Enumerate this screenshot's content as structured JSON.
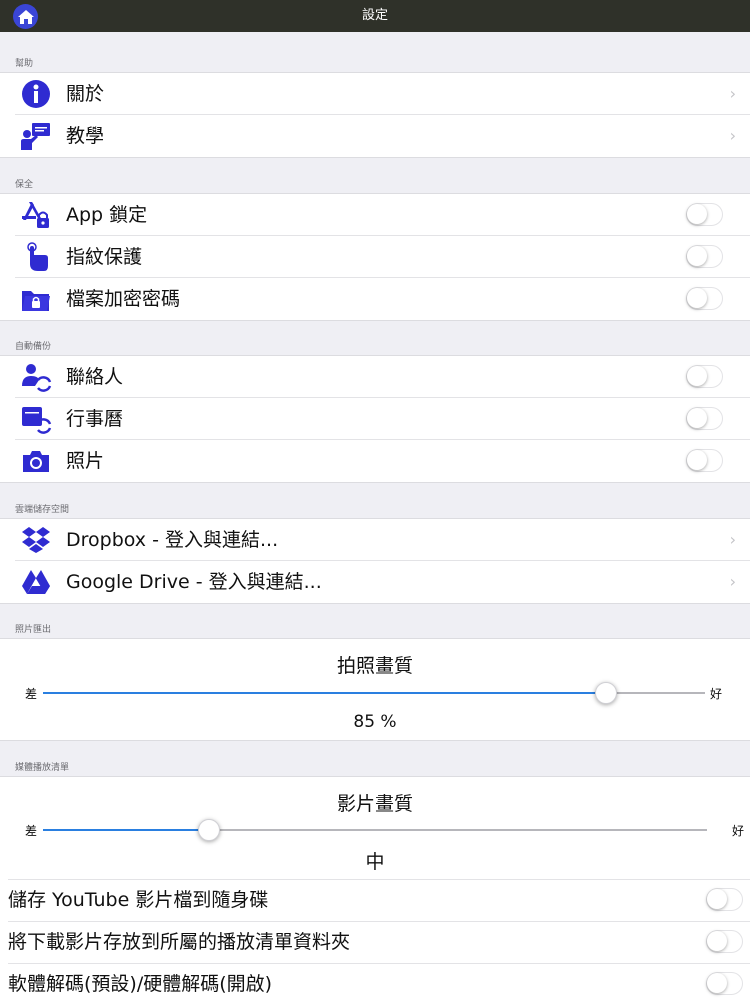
{
  "topbar": {
    "title": "設定"
  },
  "sections": {
    "help": {
      "header": "幫助",
      "items": [
        {
          "label": "關於",
          "icon": "info-icon"
        },
        {
          "label": "教學",
          "icon": "tutorial-icon"
        }
      ]
    },
    "security": {
      "header": "保全",
      "items": [
        {
          "label": "App 鎖定",
          "icon": "app-lock-icon"
        },
        {
          "label": "指紋保護",
          "icon": "fingerprint-touch-icon"
        },
        {
          "label": "檔案加密密碼",
          "icon": "folder-lock-icon"
        }
      ]
    },
    "auto_backup": {
      "header": "自動備份",
      "items": [
        {
          "label": "聯絡人",
          "icon": "contacts-sync-icon"
        },
        {
          "label": "行事曆",
          "icon": "calendar-sync-icon"
        },
        {
          "label": "照片",
          "icon": "camera-icon"
        }
      ]
    },
    "cloud": {
      "header": "雲端儲存空間",
      "items": [
        {
          "label": "Dropbox - 登入與連結...",
          "icon": "dropbox-icon"
        },
        {
          "label": "Google Drive - 登入與連結...",
          "icon": "google-drive-icon"
        }
      ]
    },
    "photo_export": {
      "header": "照片匯出",
      "slider": {
        "title": "拍照畫質",
        "min_label": "差",
        "max_label": "好",
        "value_text": "85 %",
        "value": 0.85
      }
    },
    "media_playlist": {
      "header": "媒體播放清單",
      "slider": {
        "title": "影片畫質",
        "min_label": "差",
        "max_label": "好",
        "value_text": "中",
        "value": 0.25
      },
      "items": [
        {
          "label": "儲存 YouTube 影片檔到隨身碟"
        },
        {
          "label": "將下載影片存放到所屬的播放清單資料夾"
        },
        {
          "label": "軟體解碼(預設)/硬體解碼(開啟)"
        }
      ]
    }
  },
  "toggles": {
    "all_off": true
  },
  "colors": {
    "accent": "#2a7fe0",
    "icon": "#2f2bd1",
    "topbar": "#2f3129"
  }
}
